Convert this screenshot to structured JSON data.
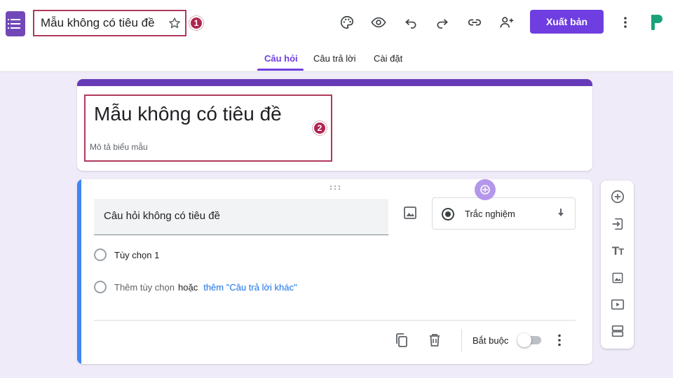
{
  "header": {
    "form_title": "Mẫu không có tiêu đề",
    "badge_1": "1",
    "publish_label": "Xuất bản",
    "toolbar_icons": [
      "palette-icon",
      "eye-icon",
      "undo-icon",
      "redo-icon",
      "link-icon",
      "add-collaborator-icon",
      "more-vert-icon"
    ]
  },
  "tabs": [
    {
      "label": "Câu hỏi",
      "active": true
    },
    {
      "label": "Câu trả lời",
      "active": false
    },
    {
      "label": "Cài đặt",
      "active": false
    }
  ],
  "title_card": {
    "title": "Mẫu không có tiêu đề",
    "description": "Mô tả biểu mẫu",
    "badge_2": "2"
  },
  "question": {
    "title": "Câu hỏi không có tiêu đề",
    "type": "Trắc nghiệm",
    "option_1": "Tùy chọn 1",
    "add_option": "Thêm tùy chọn",
    "or": "hoặc",
    "add_other": "thêm \"Câu trả lời khác\"",
    "required_label": "Bắt buộc",
    "required": false
  },
  "side_toolbar": [
    "add-question-icon",
    "import-questions-icon",
    "add-title-icon",
    "add-image-icon",
    "add-video-icon",
    "add-section-icon"
  ],
  "colors": {
    "accent": "#673ab7",
    "publish": "#6f3ee0",
    "background": "#f0ebf8",
    "highlight_border": "#b03a5b",
    "question_strip": "#4285f4",
    "link": "#1a73e8"
  }
}
